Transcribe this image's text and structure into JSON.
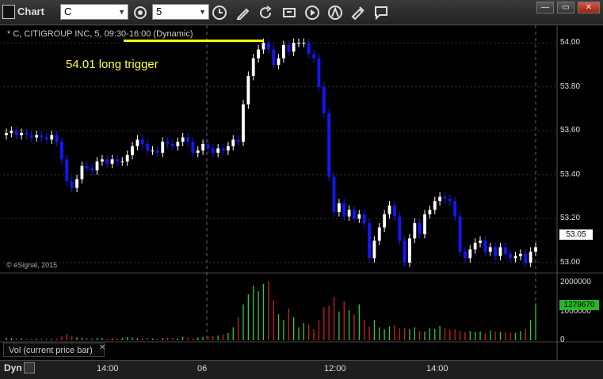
{
  "toolbar": {
    "title": "Chart",
    "symbol_value": "C",
    "interval_value": "5",
    "icons": [
      "symbol-settings-gear-icon",
      "interval-clock-icon",
      "pencil-draw-icon",
      "refresh-icon",
      "cursor-icon",
      "play-icon",
      "analyst-icon",
      "edit-icon",
      "comment-icon"
    ],
    "window_controls": [
      "minimize-icon",
      "restore-icon",
      "close-icon"
    ]
  },
  "chart": {
    "header": "* C, CITIGROUP INC, 5, 09:30-16:00 (Dynamic)",
    "annotation": "54.01 long trigger",
    "watermark": "© eSignal, 2015",
    "last_price": "53.05",
    "volume_last": "1279670",
    "volume_label": "Vol (current price bar)",
    "volume_close": "✕",
    "dyn_label": "Dyn",
    "colors": {
      "up": "#ffffff",
      "down": "#1515ff",
      "trigger": "#ffff00",
      "vol_up": "#33cc33",
      "vol_down": "#cc2222",
      "grid": "#333333"
    }
  },
  "chart_data": [
    {
      "type": "candlestick",
      "title": "",
      "y_ticks": [
        "54.00",
        "53.80",
        "53.60",
        "53.40",
        "53.20",
        "53.00"
      ],
      "ylim": [
        52.96,
        54.08
      ],
      "x_ticks": [
        "14:00",
        "06",
        "12:00",
        "14:00"
      ],
      "trigger_level": 54.01,
      "series": [
        {
          "values": [
            53.59,
            53.6,
            53.58,
            53.59,
            53.58,
            53.57,
            53.58,
            53.57,
            53.56,
            53.58,
            53.55,
            53.47,
            53.37,
            53.34,
            53.38,
            53.44,
            53.43,
            53.42,
            53.46,
            53.47,
            53.45,
            53.47,
            53.46,
            53.46,
            53.49,
            53.53,
            53.56,
            53.54,
            53.51,
            53.51,
            53.5,
            53.55,
            53.54,
            53.53,
            53.55,
            53.57,
            53.55,
            53.5,
            53.51,
            53.54,
            53.52,
            53.5,
            53.52,
            53.51,
            53.53,
            53.56,
            53.55,
            53.72,
            53.85,
            53.93,
            53.97,
            54.0,
            53.97,
            53.9,
            53.93,
            53.99,
            53.96,
            54.0,
            54.0,
            54.0,
            53.95,
            53.93,
            53.8,
            53.68,
            53.39,
            53.23,
            53.27,
            53.21,
            53.24,
            53.2,
            53.22,
            53.18,
            53.02,
            53.1,
            53.16,
            53.22,
            53.26,
            53.21,
            53.1,
            53.0,
            53.11,
            53.18,
            53.13,
            53.22,
            53.24,
            53.28,
            53.3,
            53.29,
            53.28,
            53.21,
            53.05,
            53.02,
            53.06,
            53.09,
            53.1,
            53.05,
            53.07,
            53.03,
            53.07,
            53.04,
            53.02,
            53.03,
            53.04,
            53.0,
            53.05,
            53.07
          ]
        }
      ]
    },
    {
      "type": "bar",
      "title": "Vol (current price bar)",
      "y_ticks": [
        "2000000",
        "1000000",
        "0"
      ],
      "ylim": [
        0,
        2200000
      ],
      "values": [
        95000,
        80000,
        60000,
        70000,
        45000,
        52000,
        55000,
        48000,
        62000,
        40000,
        58000,
        150000,
        220000,
        130000,
        105000,
        95000,
        88000,
        70000,
        82000,
        76000,
        60000,
        66000,
        72000,
        90000,
        110000,
        95000,
        74000,
        68000,
        84000,
        62000,
        56000,
        78000,
        92000,
        84000,
        65000,
        120000,
        88000,
        72000,
        94000,
        110000,
        128000,
        150000,
        160000,
        200000,
        250000,
        450000,
        800000,
        1250000,
        1600000,
        1900000,
        1700000,
        1950000,
        2050000,
        1400000,
        900000,
        700000,
        1100000,
        800000,
        450000,
        600000,
        550000,
        380000,
        700000,
        1150000,
        1200000,
        1500000,
        1000000,
        1350000,
        1050000,
        900000,
        1250000,
        720000,
        480000,
        700000,
        450000,
        380000,
        480000,
        520000,
        410000,
        430000,
        380000,
        450000,
        320000,
        300000,
        420000,
        390000,
        500000,
        430000,
        360000,
        380000,
        330000,
        280000,
        320000,
        290000,
        310000,
        240000,
        340000,
        300000,
        290000,
        280000,
        260000,
        250000,
        320000,
        380000,
        700000,
        1279670
      ]
    }
  ]
}
